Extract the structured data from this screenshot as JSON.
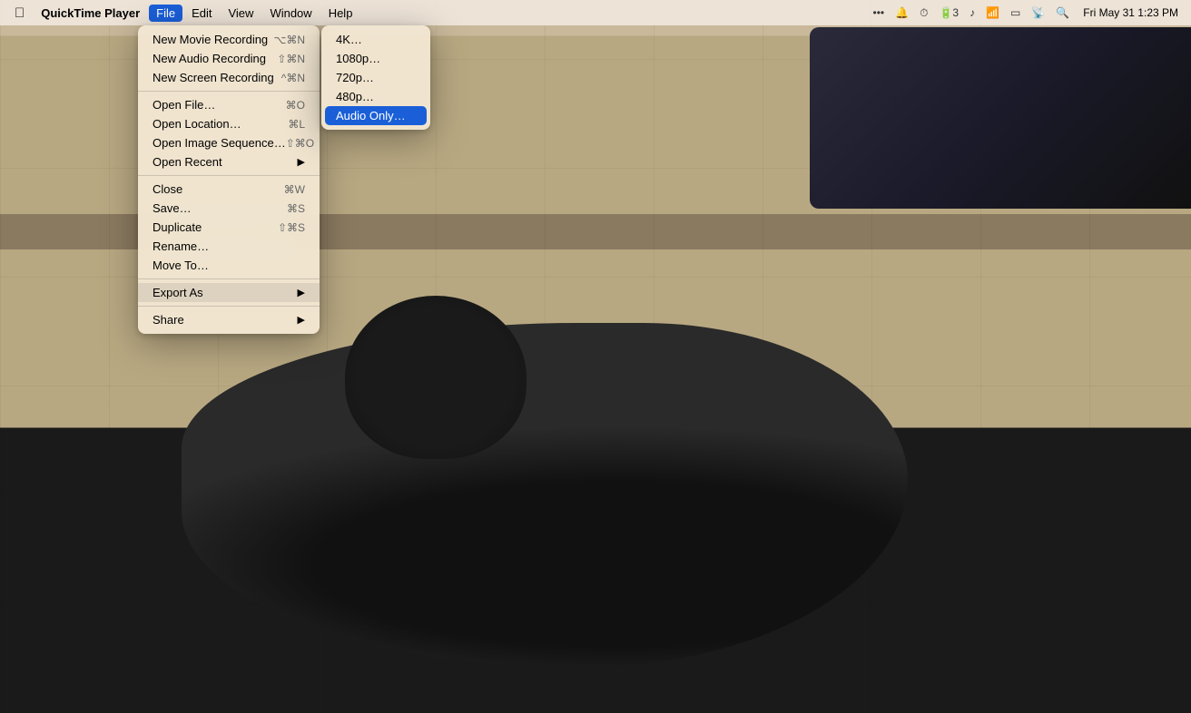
{
  "menubar": {
    "app_name": "QuickTime Player",
    "menus": [
      "File",
      "Edit",
      "View",
      "Window",
      "Help"
    ],
    "active_menu": "File",
    "clock": "Fri May 31  1:23 PM",
    "battery_icon": "🔋",
    "wifi_icon": "📶"
  },
  "file_menu": {
    "items": [
      {
        "label": "New Movie Recording",
        "shortcut": "⌥⌘N",
        "type": "item"
      },
      {
        "label": "New Audio Recording",
        "shortcut": "⇧⌘N",
        "type": "item"
      },
      {
        "label": "New Screen Recording",
        "shortcut": "^⌘N",
        "type": "item"
      },
      {
        "type": "separator"
      },
      {
        "label": "Open File…",
        "shortcut": "⌘O",
        "type": "item"
      },
      {
        "label": "Open Location…",
        "shortcut": "⌘L",
        "type": "item"
      },
      {
        "label": "Open Image Sequence…",
        "shortcut": "⇧⌘O",
        "type": "item"
      },
      {
        "label": "Open Recent",
        "arrow": "▶",
        "type": "submenu"
      },
      {
        "type": "separator"
      },
      {
        "label": "Close",
        "shortcut": "⌘W",
        "type": "item"
      },
      {
        "label": "Save…",
        "shortcut": "⌘S",
        "type": "item"
      },
      {
        "label": "Duplicate",
        "shortcut": "⇧⌘S",
        "type": "item"
      },
      {
        "label": "Rename…",
        "type": "item"
      },
      {
        "label": "Move To…",
        "type": "item"
      },
      {
        "type": "separator"
      },
      {
        "label": "Export As",
        "arrow": "▶",
        "type": "submenu",
        "active": true
      },
      {
        "type": "separator"
      },
      {
        "label": "Share",
        "arrow": "▶",
        "type": "submenu"
      }
    ]
  },
  "export_submenu": {
    "items": [
      {
        "label": "4K…"
      },
      {
        "label": "1080p…"
      },
      {
        "label": "720p…"
      },
      {
        "label": "480p…"
      },
      {
        "label": "Audio Only…",
        "highlighted": true
      }
    ]
  }
}
